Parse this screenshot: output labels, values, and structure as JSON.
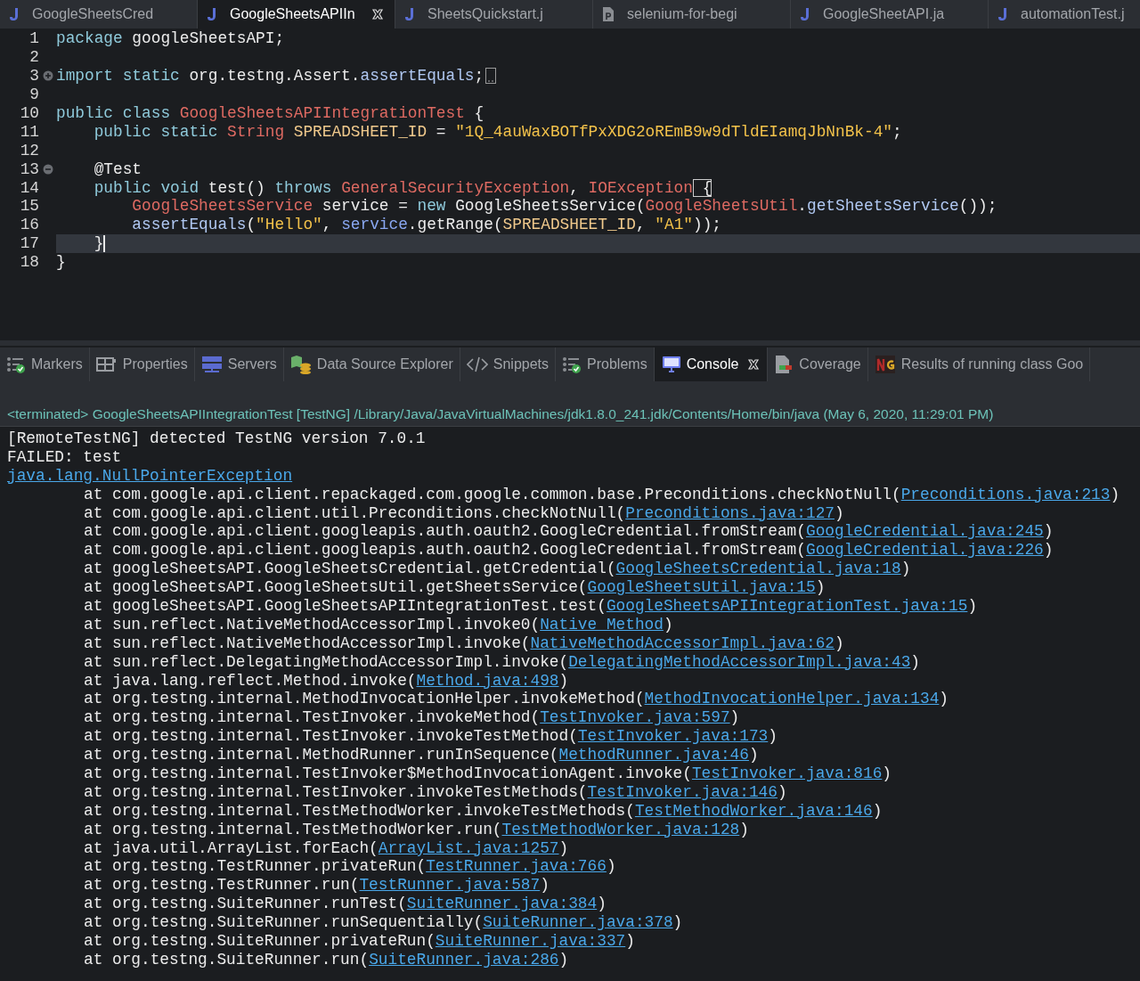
{
  "editor_tabs": [
    {
      "label": "GoogleSheetsCred",
      "kind": "java",
      "selected": false
    },
    {
      "label": "GoogleSheetsAPIIn",
      "kind": "java",
      "selected": true
    },
    {
      "label": "SheetsQuickstart.j",
      "kind": "java",
      "selected": false
    },
    {
      "label": "selenium-for-begi",
      "kind": "document",
      "selected": false
    },
    {
      "label": "GoogleSheetAPI.ja",
      "kind": "java",
      "selected": false
    },
    {
      "label": "automationTest.j",
      "kind": "java",
      "selected": false
    }
  ],
  "code_lines": [
    {
      "number": "1",
      "tokens": [
        {
          "kind": "keyword",
          "text": "package"
        },
        {
          "kind": "plain",
          "text": " googleSheetsAPI;"
        }
      ]
    },
    {
      "number": "2"
    },
    {
      "number": "3",
      "foldable": true,
      "expanded": false,
      "tokens": [
        {
          "kind": "keyword",
          "text": "import static"
        },
        {
          "kind": "plain",
          "text": " org.testng.Assert."
        },
        {
          "kind": "method",
          "text": "assertEquals"
        },
        {
          "kind": "plain",
          "text": ";"
        }
      ]
    },
    {
      "number": "9"
    },
    {
      "number": "10",
      "tokens": [
        {
          "kind": "keyword",
          "text": "public class"
        },
        {
          "kind": "type",
          "text": " GoogleSheetsAPIIntegrationTest"
        },
        {
          "kind": "plain",
          "text": " {"
        }
      ]
    },
    {
      "number": "11",
      "tokens": [
        {
          "kind": "keyword",
          "text": "    public static"
        },
        {
          "kind": "type",
          "text": " String"
        },
        {
          "kind": "constant",
          "text": " SPREADSHEET_ID"
        },
        {
          "kind": "plain",
          "text": " = "
        },
        {
          "kind": "string",
          "text": "\"1Q_4auWaxBOTfPxXDG2oREmB9w9dTldEIamqJbNnBk-4\""
        },
        {
          "kind": "plain",
          "text": ";"
        }
      ]
    },
    {
      "number": "12"
    },
    {
      "number": "13",
      "foldable": true,
      "expanded": true,
      "tokens": [
        {
          "kind": "plain",
          "text": "    @Test"
        }
      ]
    },
    {
      "number": "14",
      "tokens": [
        {
          "kind": "keyword",
          "text": "    public void"
        },
        {
          "kind": "plain",
          "text": " test() "
        },
        {
          "kind": "keyword",
          "text": "throws"
        },
        {
          "kind": "type",
          "text": " GeneralSecurityException"
        },
        {
          "kind": "plain",
          "text": ", "
        },
        {
          "kind": "type",
          "text": "IOException"
        },
        {
          "kind": "match",
          "text": " {"
        }
      ]
    },
    {
      "number": "15",
      "tokens": [
        {
          "kind": "type",
          "text": "        GoogleSheetsService"
        },
        {
          "kind": "plain",
          "text": " service = "
        },
        {
          "kind": "keyword",
          "text": "new"
        },
        {
          "kind": "plain",
          "text": " GoogleSheetsService("
        },
        {
          "kind": "type",
          "text": "GoogleSheetsUtil"
        },
        {
          "kind": "plain",
          "text": "."
        },
        {
          "kind": "method",
          "text": "getSheetsService"
        },
        {
          "kind": "plain",
          "text": "());"
        }
      ]
    },
    {
      "number": "16",
      "tokens": [
        {
          "kind": "method",
          "text": "        assertEquals"
        },
        {
          "kind": "plain",
          "text": "("
        },
        {
          "kind": "string",
          "text": "\"Hello\""
        },
        {
          "kind": "plain",
          "text": ", "
        },
        {
          "kind": "field",
          "text": "service"
        },
        {
          "kind": "plain",
          "text": ".getRange("
        },
        {
          "kind": "constant",
          "text": "SPREADSHEET_ID"
        },
        {
          "kind": "plain",
          "text": ", "
        },
        {
          "kind": "string",
          "text": "\"A1\""
        },
        {
          "kind": "plain",
          "text": "));"
        }
      ]
    },
    {
      "number": "17",
      "current": true,
      "tokens": [
        {
          "kind": "plain",
          "text": "    }"
        }
      ]
    },
    {
      "number": "18",
      "tokens": [
        {
          "kind": "plain",
          "text": "}"
        }
      ]
    }
  ],
  "view_tabs": [
    {
      "label": "Markers",
      "kind": "markers",
      "selected": false
    },
    {
      "label": "Properties",
      "kind": "properties",
      "selected": false
    },
    {
      "label": "Servers",
      "kind": "servers",
      "selected": false
    },
    {
      "label": "Data Source Explorer",
      "kind": "database",
      "selected": false
    },
    {
      "label": "Snippets",
      "kind": "snippets",
      "selected": false
    },
    {
      "label": "Problems",
      "kind": "markers",
      "selected": false
    },
    {
      "label": "Console",
      "kind": "monitor",
      "selected": true
    },
    {
      "label": "Coverage",
      "kind": "coverage",
      "selected": false
    },
    {
      "label": "Results of running class Goo",
      "kind": "testng",
      "selected": false
    }
  ],
  "console": {
    "header": "<terminated> GoogleSheetsAPIIntegrationTest [TestNG] /Library/Java/JavaVirtualMachines/jdk1.8.0_241.jdk/Contents/Home/bin/java (May 6, 2020, 11:29:01 PM)",
    "lines": [
      {
        "kind": "text",
        "text": "[RemoteTestNG] detected TestNG version 7.0.1"
      },
      {
        "kind": "text",
        "text": "FAILED: test"
      },
      {
        "kind": "link",
        "text": "java.lang.NullPointerException"
      },
      {
        "kind": "frame",
        "text": "at com.google.api.client.repackaged.com.google.common.base.Preconditions.checkNotNull(",
        "link": "Preconditions.java:213",
        "end": ")"
      },
      {
        "kind": "frame",
        "text": "at com.google.api.client.util.Preconditions.checkNotNull(",
        "link": "Preconditions.java:127",
        "end": ")"
      },
      {
        "kind": "frame",
        "text": "at com.google.api.client.googleapis.auth.oauth2.GoogleCredential.fromStream(",
        "link": "GoogleCredential.java:245",
        "end": ")"
      },
      {
        "kind": "frame",
        "text": "at com.google.api.client.googleapis.auth.oauth2.GoogleCredential.fromStream(",
        "link": "GoogleCredential.java:226",
        "end": ")"
      },
      {
        "kind": "frame",
        "text": "at googleSheetsAPI.GoogleSheetsCredential.getCredential(",
        "link": "GoogleSheetsCredential.java:18",
        "end": ")"
      },
      {
        "kind": "frame",
        "text": "at googleSheetsAPI.GoogleSheetsUtil.getSheetsService(",
        "link": "GoogleSheetsUtil.java:15",
        "end": ")"
      },
      {
        "kind": "frame",
        "text": "at googleSheetsAPI.GoogleSheetsAPIIntegrationTest.test(",
        "link": "GoogleSheetsAPIIntegrationTest.java:15",
        "end": ")"
      },
      {
        "kind": "frame",
        "text": "at sun.reflect.NativeMethodAccessorImpl.invoke0(",
        "link": "Native Method",
        "end": ")"
      },
      {
        "kind": "frame",
        "text": "at sun.reflect.NativeMethodAccessorImpl.invoke(",
        "link": "NativeMethodAccessorImpl.java:62",
        "end": ")"
      },
      {
        "kind": "frame",
        "text": "at sun.reflect.DelegatingMethodAccessorImpl.invoke(",
        "link": "DelegatingMethodAccessorImpl.java:43",
        "end": ")"
      },
      {
        "kind": "frame",
        "text": "at java.lang.reflect.Method.invoke(",
        "link": "Method.java:498",
        "end": ")"
      },
      {
        "kind": "frame",
        "text": "at org.testng.internal.MethodInvocationHelper.invokeMethod(",
        "link": "MethodInvocationHelper.java:134",
        "end": ")"
      },
      {
        "kind": "frame",
        "text": "at org.testng.internal.TestInvoker.invokeMethod(",
        "link": "TestInvoker.java:597",
        "end": ")"
      },
      {
        "kind": "frame",
        "text": "at org.testng.internal.TestInvoker.invokeTestMethod(",
        "link": "TestInvoker.java:173",
        "end": ")"
      },
      {
        "kind": "frame",
        "text": "at org.testng.internal.MethodRunner.runInSequence(",
        "link": "MethodRunner.java:46",
        "end": ")"
      },
      {
        "kind": "frame",
        "text": "at org.testng.internal.TestInvoker$MethodInvocationAgent.invoke(",
        "link": "TestInvoker.java:816",
        "end": ")"
      },
      {
        "kind": "frame",
        "text": "at org.testng.internal.TestInvoker.invokeTestMethods(",
        "link": "TestInvoker.java:146",
        "end": ")"
      },
      {
        "kind": "frame",
        "text": "at org.testng.internal.TestMethodWorker.invokeTestMethods(",
        "link": "TestMethodWorker.java:146",
        "end": ")"
      },
      {
        "kind": "frame",
        "text": "at org.testng.internal.TestMethodWorker.run(",
        "link": "TestMethodWorker.java:128",
        "end": ")"
      },
      {
        "kind": "frame",
        "text": "at java.util.ArrayList.forEach(",
        "link": "ArrayList.java:1257",
        "end": ")"
      },
      {
        "kind": "frame",
        "text": "at org.testng.TestRunner.privateRun(",
        "link": "TestRunner.java:766",
        "end": ")"
      },
      {
        "kind": "frame",
        "text": "at org.testng.TestRunner.run(",
        "link": "TestRunner.java:587",
        "end": ")"
      },
      {
        "kind": "frame",
        "text": "at org.testng.SuiteRunner.runTest(",
        "link": "SuiteRunner.java:384",
        "end": ")"
      },
      {
        "kind": "frame",
        "text": "at org.testng.SuiteRunner.runSequentially(",
        "link": "SuiteRunner.java:378",
        "end": ")"
      },
      {
        "kind": "frame",
        "text": "at org.testng.SuiteRunner.privateRun(",
        "link": "SuiteRunner.java:337",
        "end": ")"
      },
      {
        "kind": "frame",
        "text": "at org.testng.SuiteRunner.run(",
        "link": "SuiteRunner.java:286",
        "end": ")"
      }
    ]
  }
}
